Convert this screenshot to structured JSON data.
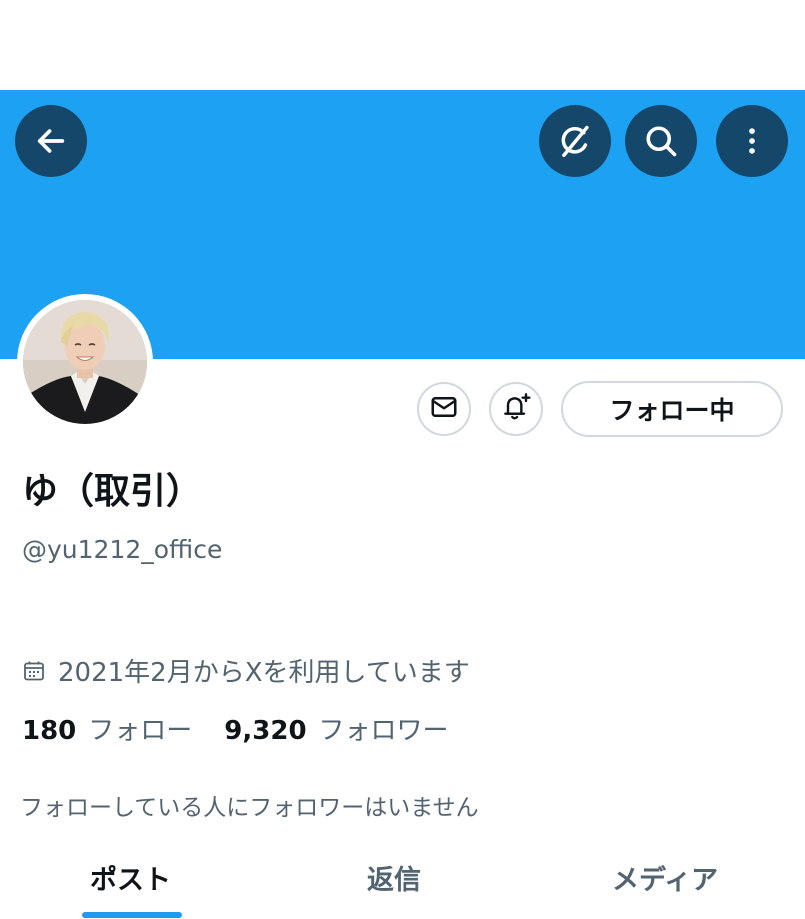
{
  "header": {
    "colors": {
      "banner": "#1da1f2",
      "button_bg": "#15476a",
      "tab_indicator": "#1d9bf0"
    },
    "icons": [
      "arrow-left-icon",
      "grok-icon",
      "search-icon",
      "more-vertical-icon"
    ]
  },
  "profile": {
    "name": "ゆ（取引）",
    "handle": "@yu1212_office",
    "joined": "2021年2月からXを利用しています",
    "avatar_icon": "avatar-photo"
  },
  "actions": {
    "message_icon": "mail-icon",
    "notify_icon": "bell-plus-icon",
    "follow_label": "フォロー中"
  },
  "stats": {
    "following_count": "180",
    "following_label": "フォロー",
    "followers_count": "9,320",
    "followers_label": "フォロワー"
  },
  "known_followers": "フォローしている人にフォロワーはいません",
  "tabs": [
    {
      "label": "ポスト",
      "active": true
    },
    {
      "label": "返信",
      "active": false
    },
    {
      "label": "メディア",
      "active": false
    }
  ]
}
